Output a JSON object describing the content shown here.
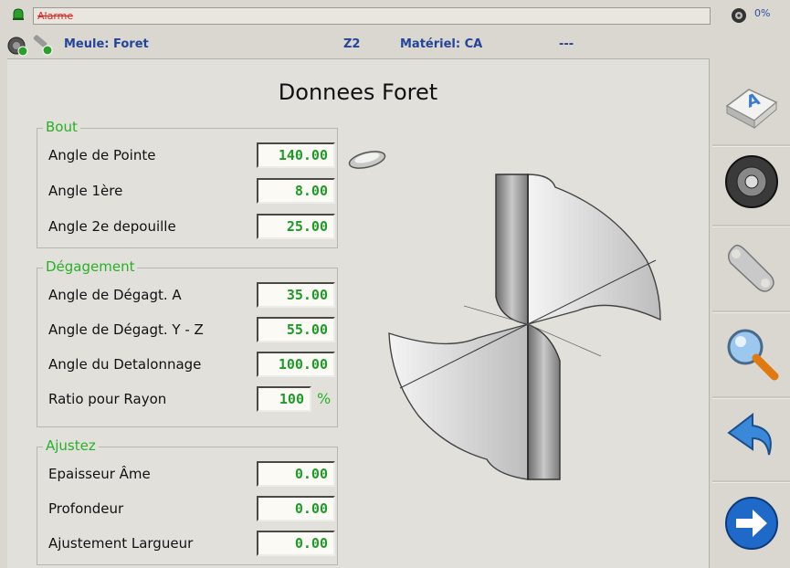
{
  "topbar": {
    "alarm_text": "Alarme",
    "progress": "0%"
  },
  "info": {
    "meule": "Meule: Foret",
    "axe": "Z2",
    "materiel": "Matériel: CA",
    "extra": "---"
  },
  "title": "Donnees Foret",
  "groups": {
    "bout": {
      "label": "Bout",
      "rows": [
        {
          "label": "Angle de Pointe",
          "value": "140.00"
        },
        {
          "label": "Angle 1ère",
          "value": "8.00"
        },
        {
          "label": "Angle 2e depouille",
          "value": "25.00"
        }
      ]
    },
    "degagement": {
      "label": "Dégagement",
      "rows": [
        {
          "label": "Angle de Dégagt. A",
          "value": "35.00"
        },
        {
          "label": "Angle de Dégagt. Y - Z",
          "value": "55.00"
        },
        {
          "label": "Angle du Detalonnage",
          "value": "100.00"
        },
        {
          "label": "Ratio pour Rayon",
          "value": "100",
          "unit": "%"
        }
      ]
    },
    "ajustez": {
      "label": "Ajustez",
      "rows": [
        {
          "label": "Epaisseur Âme",
          "value": "0.00"
        },
        {
          "label": "Profondeur",
          "value": "0.00"
        },
        {
          "label": "Ajustement Largueur",
          "value": "0.00"
        }
      ]
    }
  },
  "sidebar": {
    "buttons": [
      "keyboard-key-icon",
      "grinding-wheel-icon",
      "wrench-icon",
      "magnifier-icon",
      "undo-arrow-icon",
      "next-arrow-icon"
    ]
  },
  "colors": {
    "accent_green": "#28b028",
    "info_blue": "#24449a",
    "alarm_red": "#e02020"
  }
}
